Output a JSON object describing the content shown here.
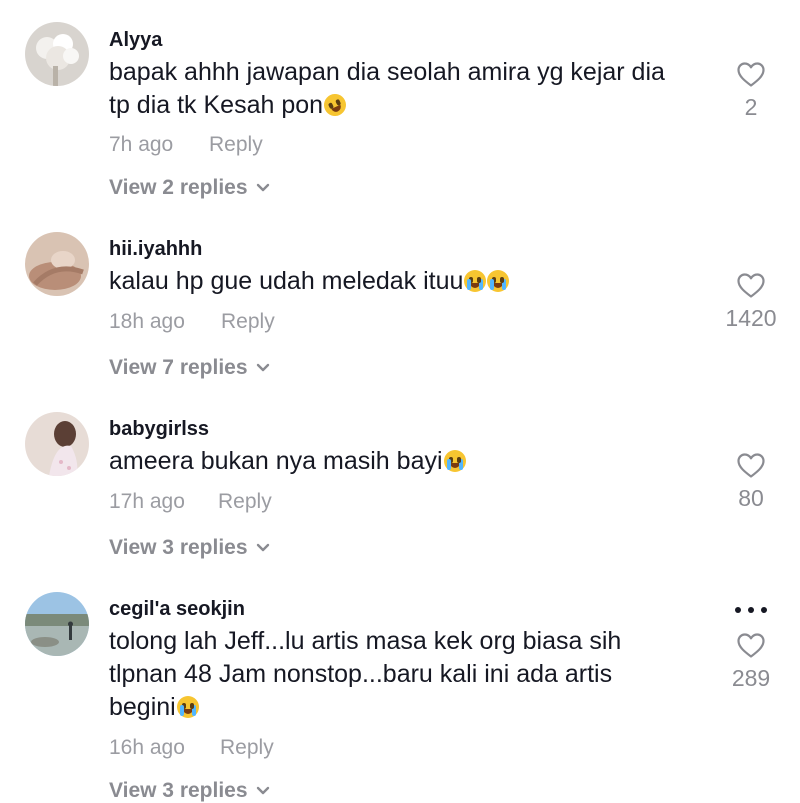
{
  "comments": [
    {
      "username": "Alyya",
      "text_line1": "bapak ahhh jawapan dia seolah amira yg kejar dia",
      "text_line2": "tp dia tk Kesah pon",
      "emoji": "rofl-emoji",
      "time": "7h ago",
      "reply_label": "Reply",
      "view_replies": "View 2 replies",
      "likes": "2"
    },
    {
      "username": "hii.iyahhh",
      "text_line1": "kalau hp gue udah meledak ituu",
      "emoji": "loudly-crying-emoji",
      "time": "18h ago",
      "reply_label": "Reply",
      "view_replies": "View 7 replies",
      "likes": "1420"
    },
    {
      "username": "babygirlss",
      "text_line1": "ameera bukan nya masih bayi",
      "emoji": "loudly-crying-emoji",
      "time": "17h ago",
      "reply_label": "Reply",
      "view_replies": "View 3 replies",
      "likes": "80"
    },
    {
      "username": "cegil'a seokjin",
      "text_line1": "tolong lah Jeff...lu artis masa kek org biasa sih",
      "text_line2": "tlpnan 48 Jam nonstop...baru kali ini ada artis",
      "text_line3": "begini",
      "emoji": "loudly-crying-emoji",
      "time": "16h ago",
      "reply_label": "Reply",
      "view_replies": "View 3 replies",
      "likes": "289"
    }
  ],
  "icons": {
    "like": "heart-outline-icon",
    "expand": "chevron-down-icon",
    "more": "more-dots-icon"
  },
  "colors": {
    "text": "#161823",
    "secondary": "#9b9ca2",
    "emoji": "#f7c531"
  }
}
